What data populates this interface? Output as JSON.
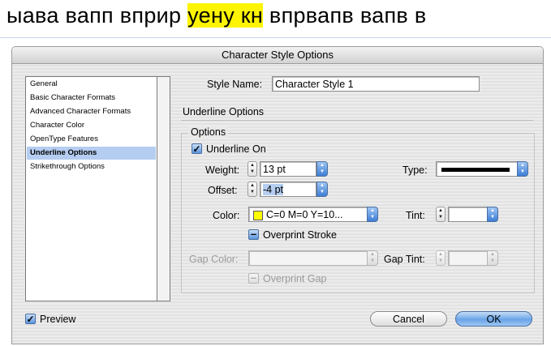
{
  "document": {
    "text_before": "ыава вапп вприр ",
    "text_highlighted": "уену кн",
    "text_after": " впрвапв  вапв в"
  },
  "dialog": {
    "title": "Character Style Options",
    "sidebar": {
      "items": [
        {
          "label": "General"
        },
        {
          "label": "Basic Character Formats"
        },
        {
          "label": "Advanced Character Formats"
        },
        {
          "label": "Character Color"
        },
        {
          "label": "OpenType Features"
        },
        {
          "label": "Underline Options",
          "selected": true
        },
        {
          "label": "Strikethrough Options"
        }
      ]
    },
    "style_name": {
      "label": "Style Name:",
      "value": "Character Style 1"
    },
    "section_title": "Underline Options",
    "options_group": {
      "legend": "Options",
      "underline_on": {
        "label": "Underline On",
        "checked": true
      },
      "weight": {
        "label": "Weight:",
        "value": "13 pt"
      },
      "offset": {
        "label": "Offset:",
        "value": "-4 pt"
      },
      "type": {
        "label": "Type:"
      },
      "color": {
        "label": "Color:",
        "value": "C=0 M=0 Y=10...",
        "swatch": "#ffff00"
      },
      "tint": {
        "label": "Tint:",
        "value": ""
      },
      "overprint_stroke": {
        "label": "Overprint Stroke"
      },
      "gap_color": {
        "label": "Gap Color:",
        "value": ""
      },
      "gap_tint": {
        "label": "Gap Tint:",
        "value": ""
      },
      "overprint_gap": {
        "label": "Overprint Gap"
      }
    },
    "preview": {
      "label": "Preview",
      "checked": true
    },
    "buttons": {
      "cancel": "Cancel",
      "ok": "OK"
    },
    "colors": {
      "accent": "#5b95e0",
      "selection": "#b4cdf0",
      "highlight": "#fcf402"
    }
  }
}
